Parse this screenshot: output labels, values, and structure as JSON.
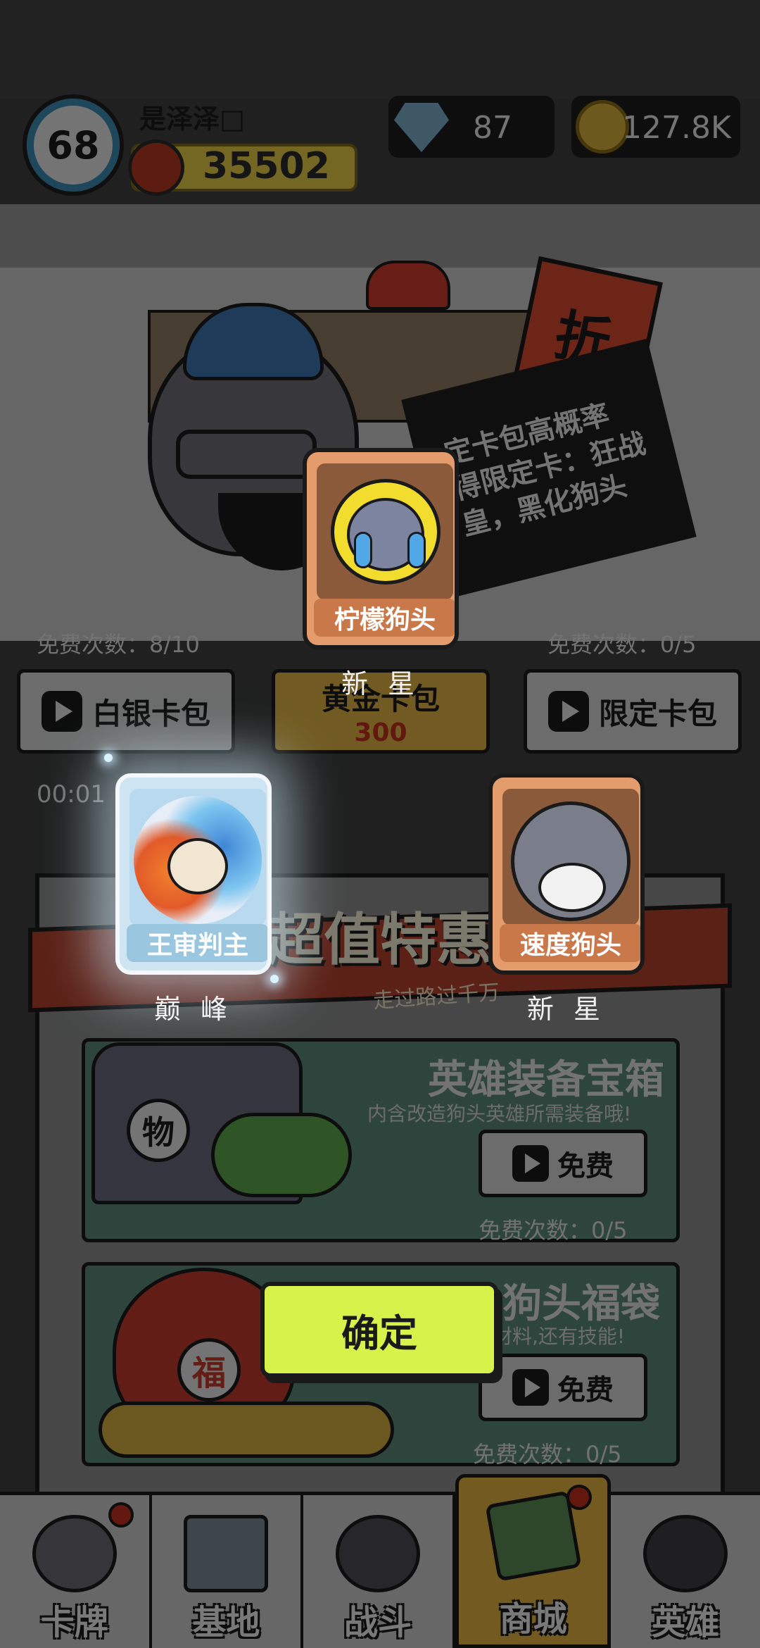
{
  "player": {
    "level": "68",
    "name": "是泽泽□",
    "power": "35502"
  },
  "resources": {
    "gems": "87",
    "coins": "127.8K"
  },
  "promo": {
    "poster_char": "折",
    "banner_text": "定卡包高概率\n得限定卡：狂战\n皇，黑化狗头"
  },
  "packs": {
    "left_free_count": "免费次数：8/10",
    "right_free_count": "免费次数：0/5",
    "silver_label": "白银卡包",
    "gold_label": "黄金卡包",
    "gold_cost": "300",
    "limited_label": "限定卡包",
    "timer": "00:01"
  },
  "deals": {
    "title": "超值特惠",
    "subtitle": "走过路过千万",
    "items": [
      {
        "name": "英雄装备宝箱",
        "desc": "内含改造狗头英雄所需装备哦!",
        "button": "免费",
        "count": "免费次数：0/5",
        "tag": "物"
      },
      {
        "name": "狗头福袋",
        "desc": "材料,还有技能!",
        "button": "免费",
        "count": "免费次数：0/5",
        "tag": "福"
      }
    ]
  },
  "rewards": [
    {
      "name": "柠檬狗头",
      "rarity": "新 星"
    },
    {
      "name": "王审判主",
      "rarity": "巅 峰"
    },
    {
      "name": "速度狗头",
      "rarity": "新 星"
    }
  ],
  "confirm_label": "确定",
  "nav": [
    {
      "label": "卡牌",
      "icon": "dog-card-icon",
      "badge": true
    },
    {
      "label": "基地",
      "icon": "castle-icon",
      "badge": false
    },
    {
      "label": "战斗",
      "icon": "paw-icon",
      "badge": false
    },
    {
      "label": "商城",
      "icon": "cash-icon",
      "badge": true
    },
    {
      "label": "英雄",
      "icon": "hero-dog-icon",
      "badge": false
    }
  ],
  "colors": {
    "accent_green": "#d7f24a",
    "rarity_orange": "#e59c6d",
    "active_tab": "#e6b443",
    "badge_red": "#c4311f"
  }
}
